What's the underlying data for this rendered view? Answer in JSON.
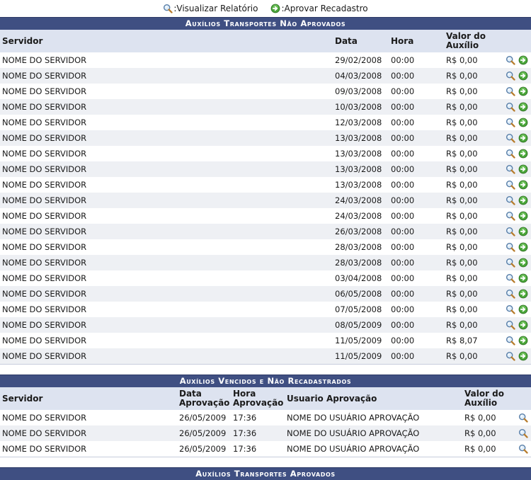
{
  "legend": {
    "view_label": ":Visualizar Relatório",
    "approve_label": ":Aprovar Recadastro"
  },
  "section1": {
    "title": "Auxílios Transportes Não Aprovados",
    "headers": {
      "servidor": "Servidor",
      "data": "Data",
      "hora": "Hora",
      "valor": "Valor do Auxílio"
    },
    "rows": [
      {
        "servidor": "NOME DO SERVIDOR",
        "data": "29/02/2008",
        "hora": "00:00",
        "valor": "R$ 0,00"
      },
      {
        "servidor": "NOME DO SERVIDOR",
        "data": "04/03/2008",
        "hora": "00:00",
        "valor": "R$ 0,00"
      },
      {
        "servidor": "NOME DO SERVIDOR",
        "data": "09/03/2008",
        "hora": "00:00",
        "valor": "R$ 0,00"
      },
      {
        "servidor": "NOME DO SERVIDOR",
        "data": "10/03/2008",
        "hora": "00:00",
        "valor": "R$ 0,00"
      },
      {
        "servidor": "NOME DO SERVIDOR",
        "data": "12/03/2008",
        "hora": "00:00",
        "valor": "R$ 0,00"
      },
      {
        "servidor": "NOME DO SERVIDOR",
        "data": "13/03/2008",
        "hora": "00:00",
        "valor": "R$ 0,00"
      },
      {
        "servidor": "NOME DO SERVIDOR",
        "data": "13/03/2008",
        "hora": "00:00",
        "valor": "R$ 0,00"
      },
      {
        "servidor": "NOME DO SERVIDOR",
        "data": "13/03/2008",
        "hora": "00:00",
        "valor": "R$ 0,00"
      },
      {
        "servidor": "NOME DO SERVIDOR",
        "data": "13/03/2008",
        "hora": "00:00",
        "valor": "R$ 0,00"
      },
      {
        "servidor": "NOME DO SERVIDOR",
        "data": "24/03/2008",
        "hora": "00:00",
        "valor": "R$ 0,00"
      },
      {
        "servidor": "NOME DO SERVIDOR",
        "data": "24/03/2008",
        "hora": "00:00",
        "valor": "R$ 0,00"
      },
      {
        "servidor": "NOME DO SERVIDOR",
        "data": "26/03/2008",
        "hora": "00:00",
        "valor": "R$ 0,00"
      },
      {
        "servidor": "NOME DO SERVIDOR",
        "data": "28/03/2008",
        "hora": "00:00",
        "valor": "R$ 0,00"
      },
      {
        "servidor": "NOME DO SERVIDOR",
        "data": "28/03/2008",
        "hora": "00:00",
        "valor": "R$ 0,00"
      },
      {
        "servidor": "NOME DO SERVIDOR",
        "data": "03/04/2008",
        "hora": "00:00",
        "valor": "R$ 0,00"
      },
      {
        "servidor": "NOME DO SERVIDOR",
        "data": "06/05/2008",
        "hora": "00:00",
        "valor": "R$ 0,00"
      },
      {
        "servidor": "NOME DO SERVIDOR",
        "data": "07/05/2008",
        "hora": "00:00",
        "valor": "R$ 0,00"
      },
      {
        "servidor": "NOME DO SERVIDOR",
        "data": "08/05/2009",
        "hora": "00:00",
        "valor": "R$ 0,00"
      },
      {
        "servidor": "NOME DO SERVIDOR",
        "data": "11/05/2009",
        "hora": "00:00",
        "valor": "R$ 8,07"
      },
      {
        "servidor": "NOME DO SERVIDOR",
        "data": "11/05/2009",
        "hora": "00:00",
        "valor": "R$ 0,00"
      }
    ]
  },
  "section2": {
    "title": "Auxílios Vencidos e Não Recadastrados",
    "headers": {
      "servidor": "Servidor",
      "data": "Data Aprovação",
      "hora": "Hora Aprovação",
      "usuario": "Usuario Aprovação",
      "valor": "Valor do Auxílio"
    },
    "rows": [
      {
        "servidor": "NOME DO SERVIDOR",
        "data": "26/05/2009",
        "hora": "17:36",
        "usuario": "NOME DO USUÁRIO APROVAÇÃO",
        "valor": "R$ 0,00"
      },
      {
        "servidor": "NOME DO SERVIDOR",
        "data": "26/05/2009",
        "hora": "17:36",
        "usuario": "NOME DO USUÁRIO APROVAÇÃO",
        "valor": "R$ 0,00"
      },
      {
        "servidor": "NOME DO SERVIDOR",
        "data": "26/05/2009",
        "hora": "17:36",
        "usuario": "NOME DO USUÁRIO APROVAÇÃO",
        "valor": "R$ 0,00"
      }
    ]
  },
  "section3": {
    "title": "Auxílios Transportes Aprovados"
  },
  "colors": {
    "caption_bg": "#3f4f82",
    "header_bg": "#dde3f0",
    "zebra_bg": "#eef0f4",
    "approve_green": "#3f9a2f"
  }
}
